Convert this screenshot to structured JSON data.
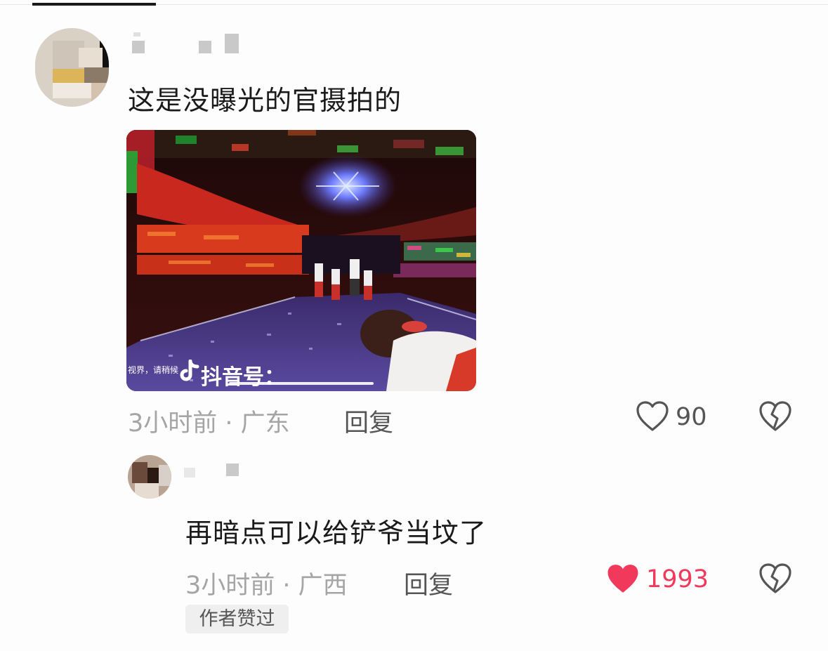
{
  "comment": {
    "text": "这是没曝光的官摄拍的",
    "meta": "3小时前 · 广东",
    "reply_label": "回复",
    "like_count": "90",
    "liked": false,
    "media": {
      "watermark_small": "视界，请稍候",
      "watermark_brand": "抖音号："
    }
  },
  "reply": {
    "text": "再暗点可以给铲爷当坟了",
    "meta": "3小时前 · 广西",
    "reply_label": "回复",
    "like_count": "1993",
    "liked": true,
    "badge": "作者赞过"
  },
  "colors": {
    "liked_red": "#f0395b",
    "muted": "#a5a5a5"
  },
  "icons": {
    "like": "heart-outline-icon",
    "liked": "heart-filled-icon",
    "dislike": "broken-heart-icon",
    "brand": "tiktok-logo-icon"
  }
}
